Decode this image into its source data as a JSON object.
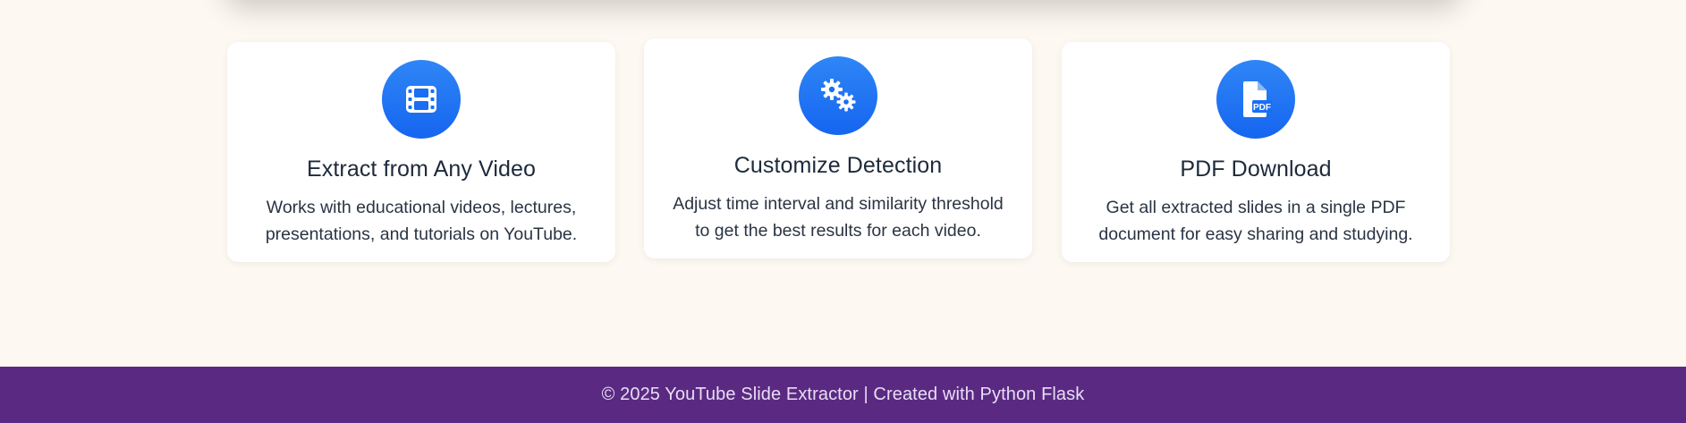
{
  "features": [
    {
      "icon": "film-icon",
      "title": "Extract from Any Video",
      "description": "Works with educational videos, lectures, presentations, and tutorials on YouTube."
    },
    {
      "icon": "gears-icon",
      "title": "Customize Detection",
      "description": "Adjust time interval and similarity threshold to get the best results for each video."
    },
    {
      "icon": "file-pdf-icon",
      "title": "PDF Download",
      "description": "Get all extracted slides in a single PDF document for easy sharing and studying."
    }
  ],
  "footer": {
    "text": "© 2025 YouTube Slide Extractor | Created with Python Flask"
  },
  "colors": {
    "page_background": "#fdf8f1",
    "card_background": "#ffffff",
    "icon_accent": "#1a6ef5",
    "footer_background": "#5a2a82",
    "title_text": "#1e2a3b"
  }
}
